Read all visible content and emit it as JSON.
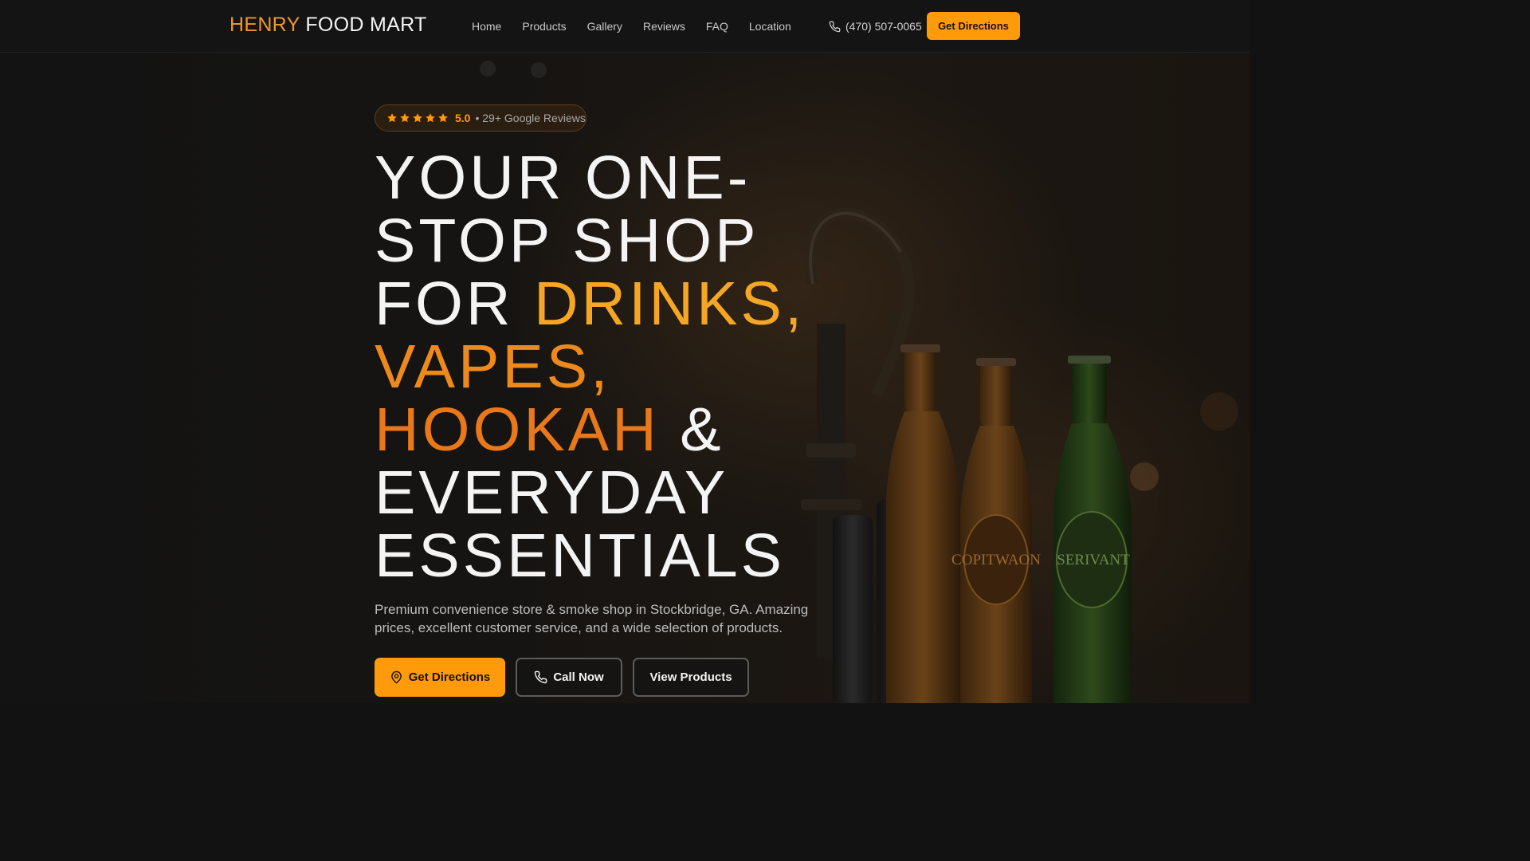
{
  "brand": {
    "part1": "HENRY",
    "part2": "FOOD MART"
  },
  "nav": {
    "links": [
      "Home",
      "Products",
      "Gallery",
      "Reviews",
      "FAQ",
      "Location"
    ],
    "phone": "(470) 507-0065",
    "cta": "Get Directions"
  },
  "hero": {
    "badge": {
      "rating": "5.0",
      "count_text": "• 29+ Google Reviews"
    },
    "headline": {
      "line1": "YOUR ONE-",
      "line2": "STOP SHOP",
      "line3_a": "FOR ",
      "line3_b": "DRINKS,",
      "line4": "VAPES,",
      "line5_a": "HOOKAH",
      "line5_b": " &",
      "line6": "EVERYDAY",
      "line7": "ESSENTIALS"
    },
    "subtitle": "Premium convenience store & smoke shop in Stockbridge, GA. Amazing prices, excellent customer service, and a wide selection of products.",
    "buttons": {
      "directions": "Get Directions",
      "call": "Call Now",
      "products": "View Products"
    },
    "bottle_labels": [
      "SERIVANT",
      "COPITWAON"
    ]
  },
  "colors": {
    "accent": "#ff9a0a",
    "background": "#121212",
    "headline_white": "#f4f4f4",
    "headline_orange": "#f5a623"
  }
}
